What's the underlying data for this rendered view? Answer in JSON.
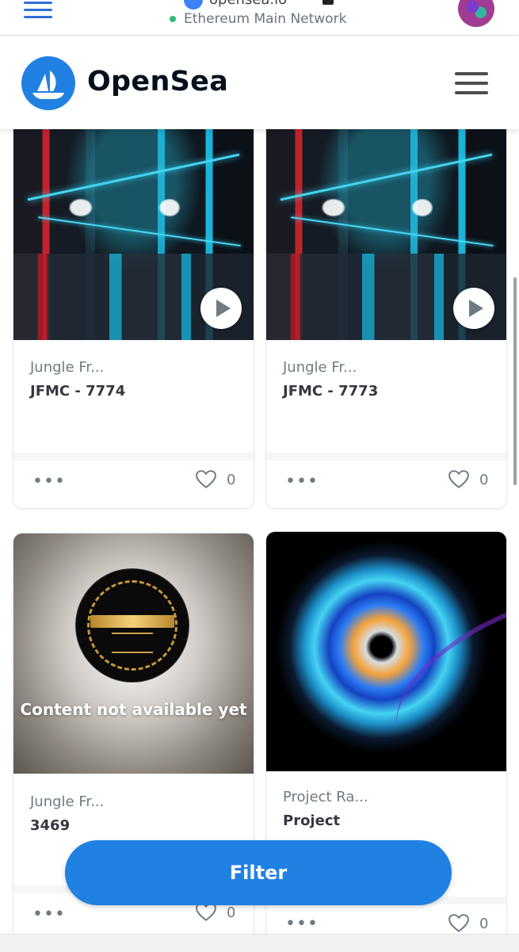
{
  "wallet": {
    "title": "opensea.io",
    "network": "Ethereum Main Network",
    "colors": {
      "accent": "#2f6fd8",
      "network_dot": "#35b87d"
    }
  },
  "header": {
    "brand": "OpenSea",
    "brand_color": "#2081e2"
  },
  "cards": [
    {
      "collection": "Jungle Fr...",
      "name": "JFMC - 7774",
      "likes": "0",
      "media": "video",
      "more": "•••"
    },
    {
      "collection": "Jungle Fr...",
      "name": "JFMC - 7773",
      "likes": "0",
      "media": "video",
      "more": "•••"
    },
    {
      "collection": "Jungle Fr...",
      "name": "3469",
      "likes": "0",
      "media": "unavailable",
      "media_text": "Content not available yet",
      "more": "•••"
    },
    {
      "collection": "Project Ra...",
      "name": "Project",
      "likes": "0",
      "media": "image",
      "more": "•••"
    }
  ],
  "filter": {
    "label": "Filter"
  }
}
